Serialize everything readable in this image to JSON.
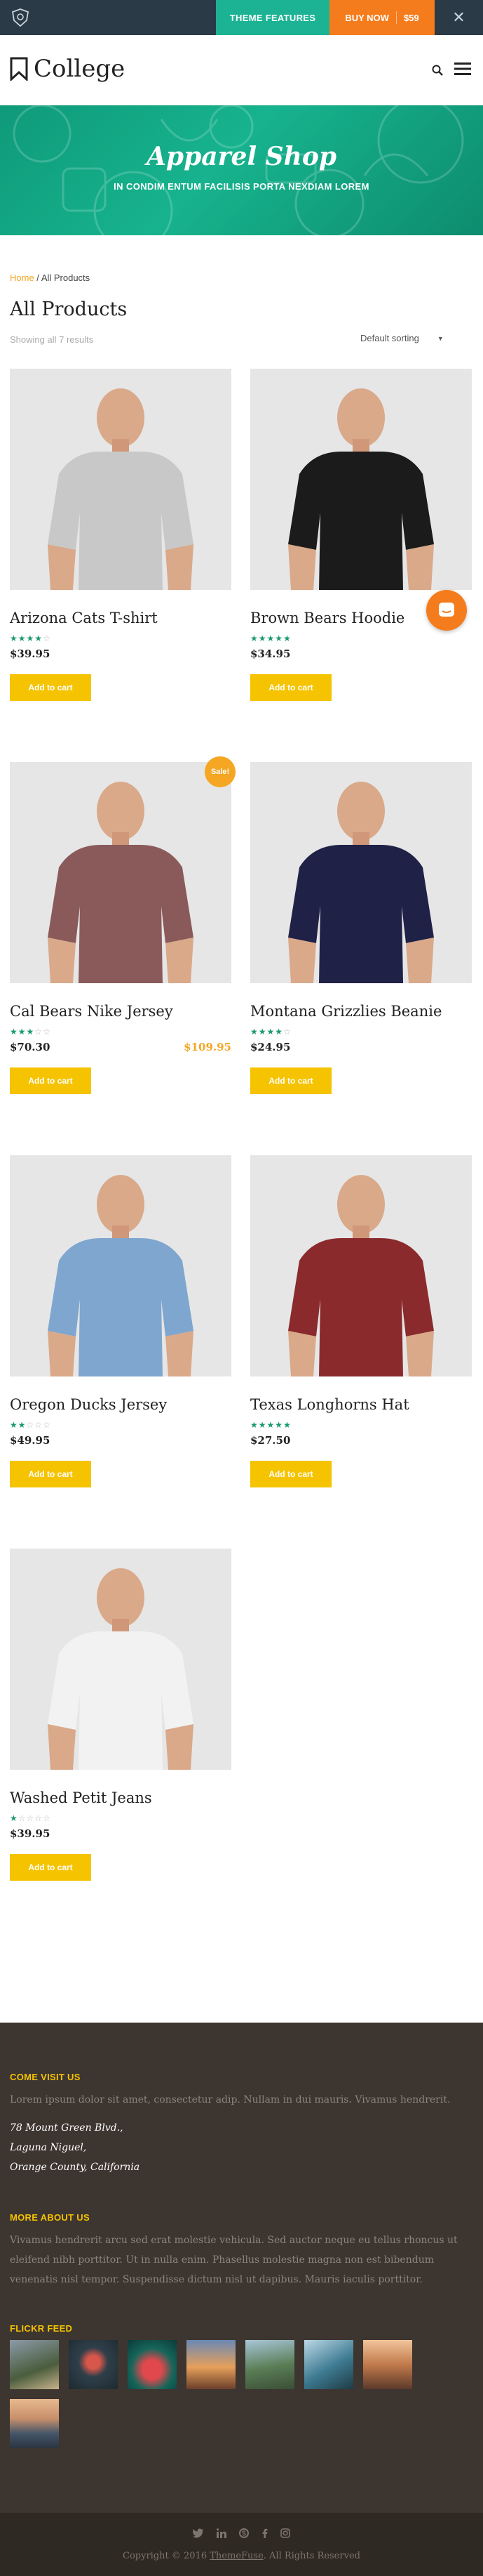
{
  "topbar": {
    "features_label": "THEME FEATURES",
    "buy_label": "BUY NOW",
    "buy_price": "$59"
  },
  "header": {
    "brand": "College"
  },
  "hero": {
    "title": "Apparel Shop",
    "subtitle": "IN CONDIM ENTUM FACILISIS PORTA NEXDIAM LOREM"
  },
  "breadcrumb": {
    "home": "Home",
    "sep": " / ",
    "current": "All Products"
  },
  "page_title": "All Products",
  "result_count": "Showing all 7 results",
  "sorting": {
    "selected": "Default sorting"
  },
  "colors": {
    "accent_teal": "#1bb394",
    "accent_orange": "#f57c1c",
    "button_yellow": "#f5c300",
    "star_green": "#1a9a6c"
  },
  "products": [
    {
      "name": "Arizona Cats T-shirt",
      "rating": 4,
      "price": "$39.95",
      "old_price": "",
      "sale": false,
      "button": "Add to cart"
    },
    {
      "name": "Brown Bears Hoodie",
      "rating": 5,
      "price": "$34.95",
      "old_price": "",
      "sale": false,
      "button": "Add to cart"
    },
    {
      "name": "Cal Bears Nike Jersey",
      "rating": 3,
      "price": "$70.30",
      "old_price": "$109.95",
      "sale": true,
      "sale_label": "Sale!",
      "button": "Add to cart"
    },
    {
      "name": "Montana Grizzlies Beanie",
      "rating": 4,
      "price": "$24.95",
      "old_price": "",
      "sale": false,
      "button": "Add to cart"
    },
    {
      "name": "Oregon Ducks Jersey",
      "rating": 2,
      "price": "$49.95",
      "old_price": "",
      "sale": false,
      "button": "Add to cart"
    },
    {
      "name": "Texas Longhorns Hat",
      "rating": 5,
      "price": "$27.50",
      "old_price": "",
      "sale": false,
      "button": "Add to cart"
    },
    {
      "name": "Washed Petit Jeans",
      "rating": 1,
      "price": "$39.95",
      "old_price": "",
      "sale": false,
      "button": "Add to cart"
    }
  ],
  "footer": {
    "visit_title": "COME VISIT US",
    "visit_text": "Lorem ipsum dolor sit amet, consectetur adip. Nullam in dui mauris. Vivamus hendrerit.",
    "address_line1": "78 Mount Green Blvd.,",
    "address_line2": "Laguna Niguel,",
    "address_line3": "Orange County, California",
    "about_title": "MORE ABOUT US",
    "about_text": "Vivamus hendrerit arcu sed erat molestie vehicula. Sed auctor neque eu tellus rhoncus ut eleifend nibh porttitor. Ut in nulla enim. Phasellus molestie magna non est bibendum venenatis nisl tempor. Suspendisse dictum nisl ut dapibus. Mauris iaculis porttitor.",
    "flickr_title": "FLICKR FEED",
    "copyright_prefix": "Copyright © 2016 ",
    "copyright_brand": "ThemeFuse",
    "copyright_suffix": ". All Rights Reserved"
  }
}
